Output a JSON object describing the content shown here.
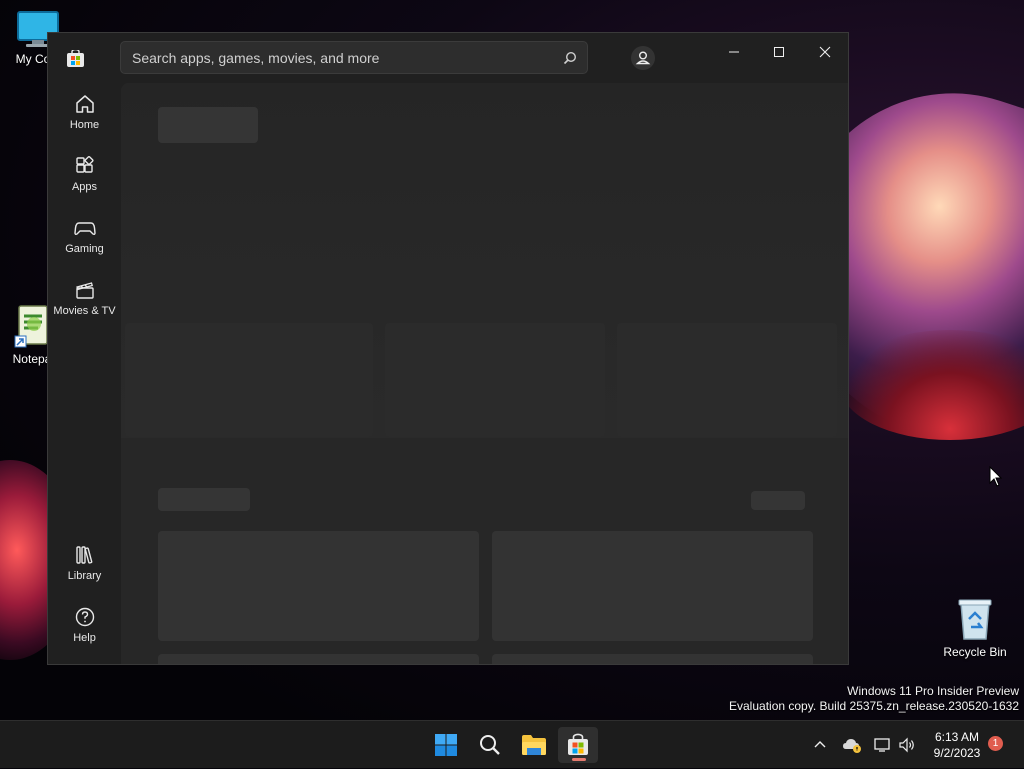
{
  "desktop": {
    "icons": [
      {
        "label": "My Com"
      },
      {
        "label": "Notepa"
      },
      {
        "label": "Recycle Bin"
      }
    ],
    "watermark": {
      "line1": "Windows 11 Pro Insider Preview",
      "line2": "Evaluation copy. Build 25375.zn_release.230520-1632"
    }
  },
  "window": {
    "search_placeholder": "Search apps, games, movies, and more",
    "nav": [
      {
        "label": "Home",
        "icon": "home-icon"
      },
      {
        "label": "Apps",
        "icon": "apps-icon"
      },
      {
        "label": "Gaming",
        "icon": "gaming-icon"
      },
      {
        "label": "Movies & TV",
        "icon": "movies-tv-icon"
      },
      {
        "label": "Library",
        "icon": "library-icon"
      },
      {
        "label": "Help",
        "icon": "help-icon"
      }
    ]
  },
  "taskbar": {
    "time": "6:13 AM",
    "date": "9/2/2023",
    "notification_count": "1"
  }
}
